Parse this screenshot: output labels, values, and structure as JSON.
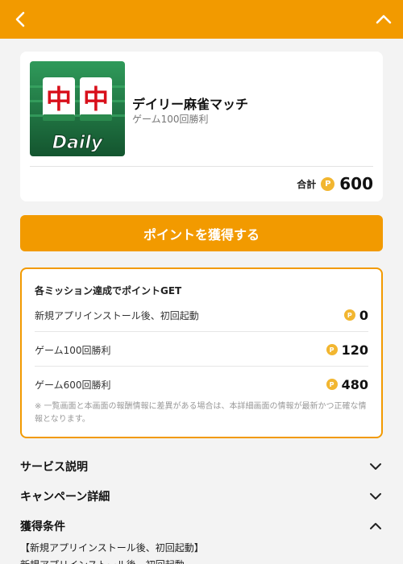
{
  "header": {
    "back_icon": "chevron-left-icon",
    "collapse_icon": "chevron-up-icon",
    "color": "#f29a00"
  },
  "game": {
    "title": "デイリー麻雀マッチ",
    "subtitle": "ゲーム100回勝利",
    "thumb_tiles": [
      "中",
      "中"
    ],
    "thumb_logo": "Daily",
    "total_label": "合計",
    "total_value": "600",
    "coin_glyph": "P"
  },
  "cta": {
    "label": "ポイントを獲得する"
  },
  "missions": {
    "heading": "各ミッション達成でポイントGET",
    "rows": [
      {
        "label": "新規アプリインストール後、初回起動",
        "points": "0"
      },
      {
        "label": "ゲーム100回勝利",
        "points": "120"
      },
      {
        "label": "ゲーム600回勝利",
        "points": "480"
      }
    ],
    "note": "※ 一覧画面と本画面の報酬情報に差異がある場合は、本詳細画面の情報が最新かつ正確な情報となります。"
  },
  "accordions": [
    {
      "label": "サービス説明",
      "state": "collapsed"
    },
    {
      "label": "キャンペーン詳細",
      "state": "collapsed"
    },
    {
      "label": "獲得条件",
      "state": "expanded"
    }
  ],
  "conditions": {
    "line1": "【新規アプリインストール後、初回起動】",
    "line2": "新規アプリインストール後、初回起動"
  },
  "colors": {
    "accent": "#f29a00",
    "coin": "#f2b630",
    "background": "#f3f3f3"
  }
}
